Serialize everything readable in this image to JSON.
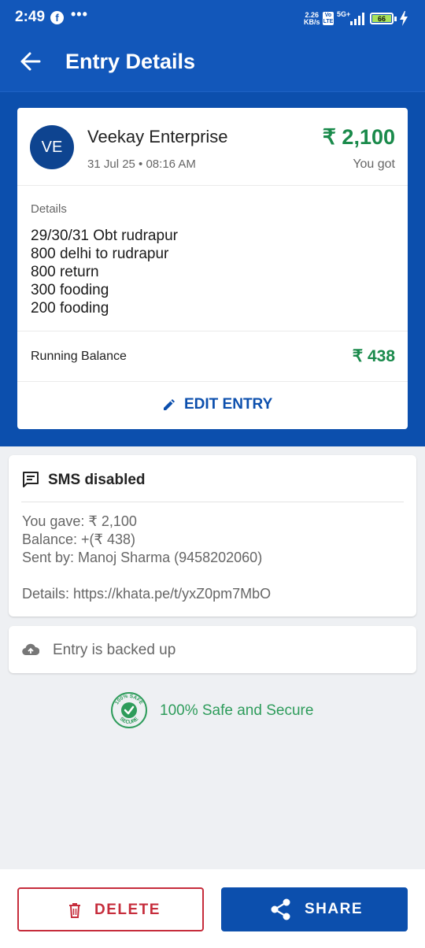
{
  "status_bar": {
    "time": "2:49",
    "more_dots": "•••",
    "net_speed_value": "2.26",
    "net_speed_unit": "KB/s",
    "volte": "Vo LTE",
    "net_type": "5G+",
    "battery": "66"
  },
  "header": {
    "title": "Entry Details"
  },
  "entry": {
    "avatar_initials": "VE",
    "party_name": "Veekay Enterprise",
    "datetime": "31 Jul 25 • 08:16 AM",
    "amount": "₹ 2,100",
    "amount_caption": "You got",
    "details_label": "Details",
    "details_text": "29/30/31 Obt rudrapur\n800 delhi to rudrapur\n800 return\n300 fooding\n200 fooding",
    "running_balance_label": "Running Balance",
    "running_balance_value": "₹ 438",
    "edit_label": "EDIT ENTRY",
    "amount_color": "#1a8a4b"
  },
  "sms": {
    "title": "SMS disabled",
    "lines": [
      "You gave: ₹ 2,100",
      "Balance: +(₹ 438)",
      "Sent by: Manoj Sharma (9458202060)",
      "Details: https://khata.pe/t/yxZ0pm7MbO"
    ]
  },
  "backup": {
    "text": "Entry is backed up"
  },
  "safe": {
    "text": "100% Safe and Secure",
    "badge_top": "100% SAFE",
    "badge_bottom": "SECURE"
  },
  "actions": {
    "delete_label": "DELETE",
    "share_label": "SHARE"
  },
  "colors": {
    "primary": "#0c4fad",
    "header": "#1257ba",
    "positive": "#1a8a4b",
    "danger": "#c62d3c"
  },
  "icons": [
    "facebook-icon",
    "more-icon",
    "signal-icon",
    "battery-icon",
    "charging-icon",
    "back-arrow-icon",
    "edit-pencil-icon",
    "sms-icon",
    "cloud-upload-icon",
    "safe-secure-badge-icon",
    "trash-icon",
    "share-icon"
  ]
}
